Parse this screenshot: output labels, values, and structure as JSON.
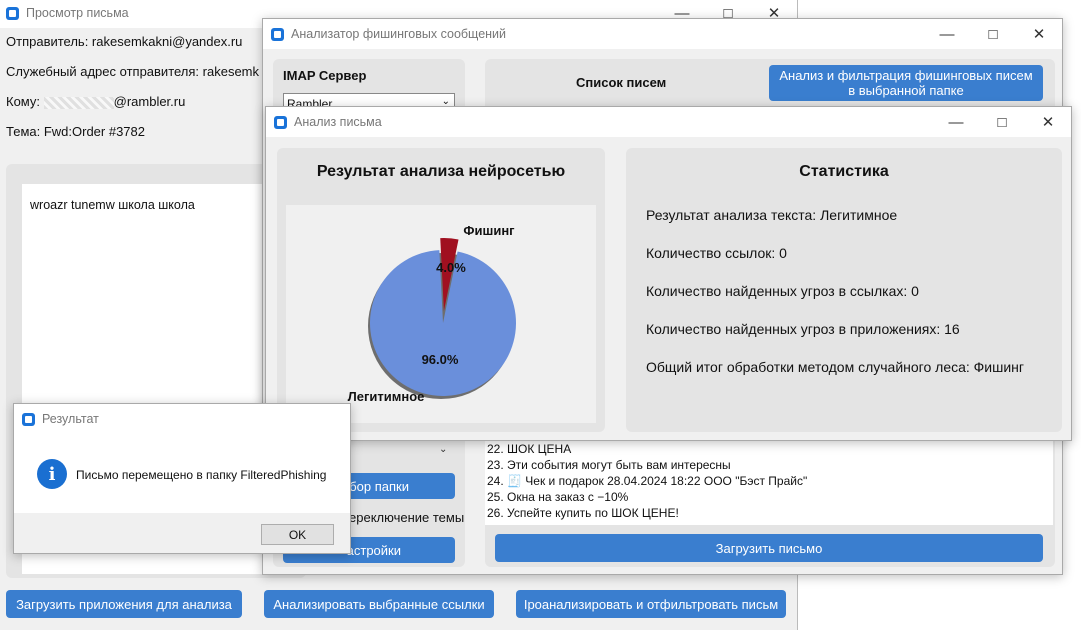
{
  "viewer": {
    "title": "Просмотр письма",
    "sender": "Отправитель: rakesemkakni@yandex.ru",
    "service_sender": "Служебный адрес отправителя: rakesemk",
    "to_prefix": "Кому:",
    "to_domain": "@rambler.ru",
    "subject": "Тема: Fwd:Order #3782",
    "body": "wroazr tunemw школа школа",
    "btn_attachments": "Загрузить приложения для анализа",
    "btn_links": "Анализировать выбранные ссылки",
    "btn_analyze_filter": "Іроанализировать и отфильтровать письм"
  },
  "analyzer": {
    "title": "Анализатор фишинговых сообщений",
    "imap_label": "IMAP Сервер",
    "imap_value": "Rambler",
    "list_title": "Список писем",
    "btn_filter": "Анализ и фильтрация фишинговых писем в выбранной папке",
    "btn_folder": "ыбор папки",
    "theme_label": "ереключение темы",
    "btn_settings": "астройки",
    "email_list": [
      "22. ШОК ЦЕНА",
      "23. Эти события могут быть вам интересны",
      "24. 🧾 Чек и подарок 28.04.2024 18:22 ООО \"Бэст Прайс\"",
      "25. Окна на заказ с −10%",
      "26. Успейте купить по ШОК ЦЕНЕ!"
    ],
    "btn_load_email": "Загрузить письмо"
  },
  "analysis": {
    "title": "Анализ письма",
    "nn_title": "Результат анализа нейросетью",
    "stats_title": "Статистика",
    "stats": [
      "Результат анализа текста: Легитимное",
      "Количество ссылок: 0",
      "Количество найденных угроз в ссылках: 0",
      "Количество найденных угроз в приложениях: 16",
      "Общий итог обработки методом случайного леса: Фишинг"
    ]
  },
  "chart_data": {
    "type": "pie",
    "slices": [
      {
        "label": "Фишинг",
        "value": 4.0,
        "display": "4.0%",
        "color": "#a01020"
      },
      {
        "label": "Легитимное",
        "value": 96.0,
        "display": "96.0%",
        "color": "#6a8fdb"
      }
    ]
  },
  "result": {
    "title": "Результат",
    "message": "Письмо перемещено в папку FilteredPhishing",
    "ok": "OK"
  },
  "colors": {
    "accent": "#3a7ecf",
    "phishing": "#a01020",
    "legit": "#6a8fdb"
  }
}
